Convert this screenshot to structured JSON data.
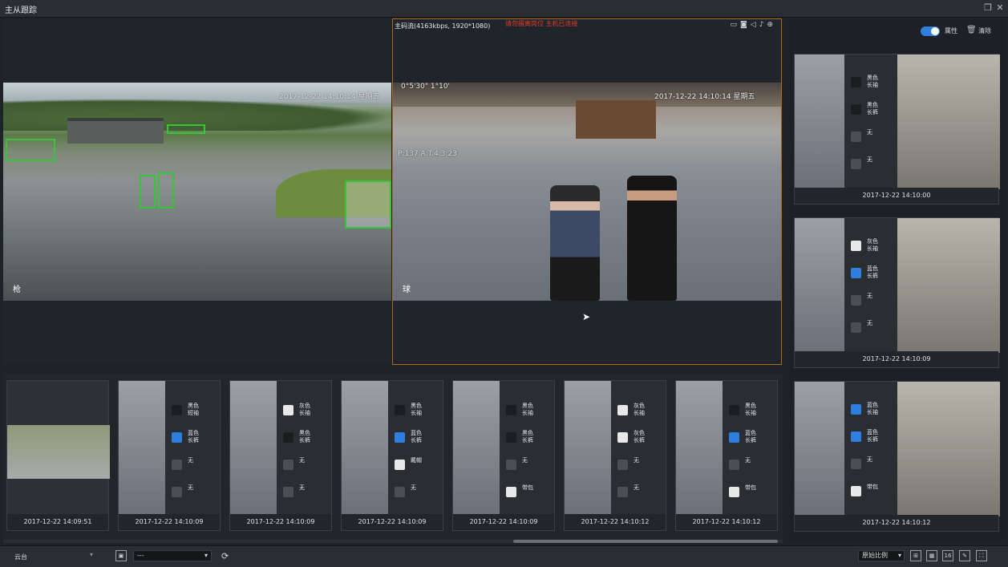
{
  "window": {
    "title": "主从跟踪"
  },
  "left_video": {
    "osd_time": "2017-12-22 14:10:14 星期五",
    "corner_label": "枪"
  },
  "right_video": {
    "stream_info": "主码流(4163kbps, 1920*1080)",
    "warning": "请勿擅离岗位 主机已连接",
    "osd_time": "2017-12-22 14:10:14 星期五",
    "osd_ptz": "0°5'30\" 1°10'",
    "osd_zoom": "P:137.A:T:4.3:23",
    "corner_label": "球",
    "icons": [
      "camera-icon",
      "snapshot-icon",
      "audio-icon",
      "mic-icon",
      "zoom-icon"
    ]
  },
  "right_panel": {
    "toggle_label": "属性",
    "clear_label": "清除"
  },
  "side_cards": [
    {
      "timestamp": "2017-12-22 14:10:00",
      "attrs": [
        {
          "icon": "top-icon",
          "color": "#1b1d21",
          "text": "黑色 长袖"
        },
        {
          "icon": "pants-icon",
          "color": "#1b1d21",
          "text": "黑色 长裤"
        },
        {
          "icon": "hat-icon",
          "color": "#4a4f55",
          "text": "无"
        },
        {
          "icon": "bag-icon",
          "color": "#4a4f55",
          "text": "无"
        }
      ]
    },
    {
      "timestamp": "2017-12-22 14:10:09",
      "attrs": [
        {
          "icon": "top-icon",
          "color": "#e8e8e8",
          "text": "灰色 长袖"
        },
        {
          "icon": "pants-icon",
          "color": "#2f7fe0",
          "text": "蓝色 长裤"
        },
        {
          "icon": "hat-icon",
          "color": "#4a4f55",
          "text": "无"
        },
        {
          "icon": "bag-icon",
          "color": "#4a4f55",
          "text": "无"
        }
      ]
    },
    {
      "timestamp": "2017-12-22 14:10:12",
      "attrs": [
        {
          "icon": "top-icon",
          "color": "#2f7fe0",
          "text": "蓝色 长袖"
        },
        {
          "icon": "pants-icon",
          "color": "#2f7fe0",
          "text": "蓝色 长裤"
        },
        {
          "icon": "hat-icon",
          "color": "#4a4f55",
          "text": "无"
        },
        {
          "icon": "bag-icon",
          "color": "#e8e8e8",
          "text": "带包"
        }
      ]
    }
  ],
  "strip_cards": [
    {
      "timestamp": "2017-12-22 14:09:51",
      "attrs": []
    },
    {
      "timestamp": "2017-12-22 14:10:09",
      "attrs": [
        {
          "icon": "top-icon",
          "color": "#1b1d21",
          "text": "黑色 短袖"
        },
        {
          "icon": "pants-icon",
          "color": "#2f7fe0",
          "text": "蓝色 长裤"
        },
        {
          "icon": "hat-icon",
          "color": "#4a4f55",
          "text": "无"
        },
        {
          "icon": "bag-icon",
          "color": "#4a4f55",
          "text": "无"
        }
      ]
    },
    {
      "timestamp": "2017-12-22 14:10:09",
      "attrs": [
        {
          "icon": "top-icon",
          "color": "#e8e8e8",
          "text": "灰色 长袖"
        },
        {
          "icon": "pants-icon",
          "color": "#1b1d21",
          "text": "黑色 长裤"
        },
        {
          "icon": "hat-icon",
          "color": "#4a4f55",
          "text": "无"
        },
        {
          "icon": "bag-icon",
          "color": "#4a4f55",
          "text": "无"
        }
      ]
    },
    {
      "timestamp": "2017-12-22 14:10:09",
      "attrs": [
        {
          "icon": "top-icon",
          "color": "#1b1d21",
          "text": "黑色 长袖"
        },
        {
          "icon": "pants-icon",
          "color": "#2f7fe0",
          "text": "蓝色 长裤"
        },
        {
          "icon": "hat-icon",
          "color": "#e8e8e8",
          "text": "戴帽"
        },
        {
          "icon": "bag-icon",
          "color": "#4a4f55",
          "text": "无"
        }
      ]
    },
    {
      "timestamp": "2017-12-22 14:10:09",
      "attrs": [
        {
          "icon": "top-icon",
          "color": "#1b1d21",
          "text": "黑色 长袖"
        },
        {
          "icon": "pants-icon",
          "color": "#1b1d21",
          "text": "黑色 长裤"
        },
        {
          "icon": "hat-icon",
          "color": "#4a4f55",
          "text": "无"
        },
        {
          "icon": "bag-icon",
          "color": "#e8e8e8",
          "text": "带包"
        }
      ]
    },
    {
      "timestamp": "2017-12-22 14:10:12",
      "attrs": [
        {
          "icon": "top-icon",
          "color": "#e8e8e8",
          "text": "灰色 长袖"
        },
        {
          "icon": "pants-icon",
          "color": "#e8e8e8",
          "text": "灰色 长裤"
        },
        {
          "icon": "hat-icon",
          "color": "#4a4f55",
          "text": "无"
        },
        {
          "icon": "bag-icon",
          "color": "#4a4f55",
          "text": "无"
        }
      ]
    },
    {
      "timestamp": "2017-12-22 14:10:12",
      "attrs": [
        {
          "icon": "top-icon",
          "color": "#1b1d21",
          "text": "黑色 长袖"
        },
        {
          "icon": "pants-icon",
          "color": "#2f7fe0",
          "text": "蓝色 长裤"
        },
        {
          "icon": "hat-icon",
          "color": "#4a4f55",
          "text": "无"
        },
        {
          "icon": "bag-icon",
          "color": "#e8e8e8",
          "text": "带包"
        }
      ]
    }
  ],
  "toolbar": {
    "ptz_label": "云台",
    "preset_value": "---",
    "ratio_value": "原始比例",
    "layout_16": "16"
  }
}
